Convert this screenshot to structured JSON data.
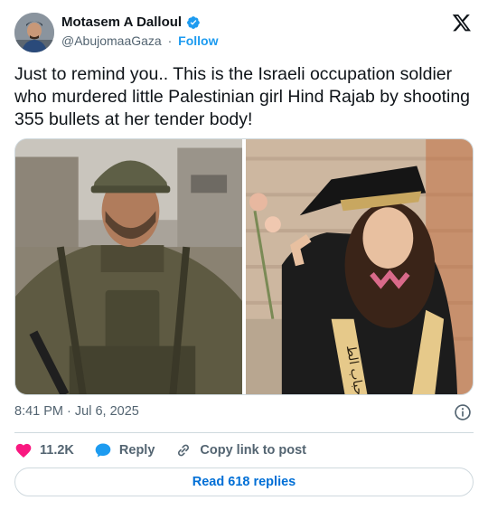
{
  "author": {
    "name": "Motasem A Dalloul",
    "handle": "@AbujomaaGaza",
    "separator": "·",
    "follow_label": "Follow"
  },
  "tweet": {
    "text": "Just to remind you.. This is the Israeli occupation soldier who murdered little Palestinian girl Hind Rajab by shooting 355 bullets at her tender body!",
    "timestamp": "8:41 PM · Jul 6, 2025"
  },
  "media": {
    "right_image_sash_text": "أحباب الط"
  },
  "actions": {
    "likes": "11.2K",
    "reply_label": "Reply",
    "copy_link_label": "Copy link to post"
  },
  "read_replies_label": "Read 618 replies",
  "colors": {
    "brand_blue": "#1d9bf0",
    "link_blue": "#006fd6",
    "like_pink": "#f91880",
    "muted_text": "#536471",
    "border": "#cfd9de"
  },
  "icons": [
    "verified-badge-icon",
    "x-logo-icon",
    "info-icon",
    "heart-icon",
    "reply-bubble-icon",
    "link-icon"
  ]
}
